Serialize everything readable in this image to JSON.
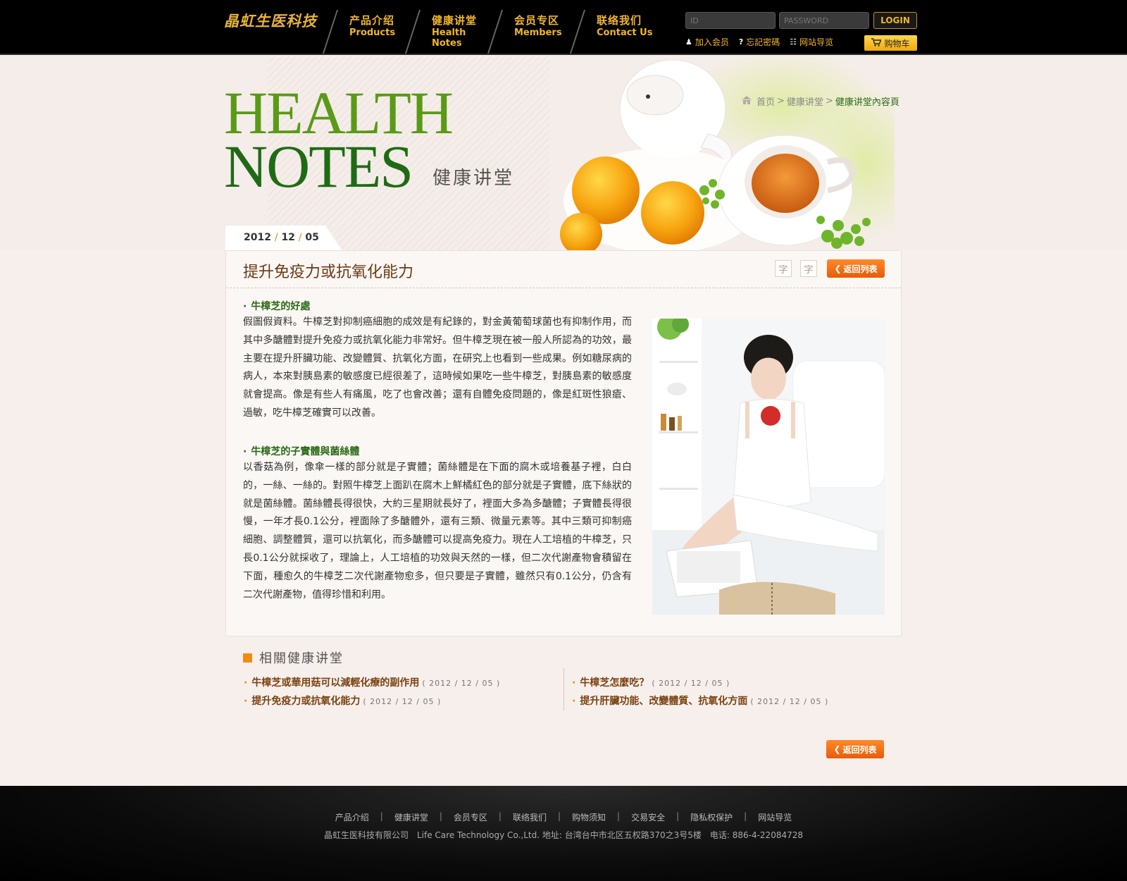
{
  "header": {
    "logo": "晶虹生医科技",
    "nav": [
      {
        "cn": "产品介绍",
        "en": "Products"
      },
      {
        "cn": "健康讲堂",
        "en": "Health Notes"
      },
      {
        "cn": "会员专区",
        "en": "Members"
      },
      {
        "cn": "联络我们",
        "en": "Contact Us"
      }
    ],
    "login": {
      "id_placeholder": "ID",
      "password_placeholder": "PASSWORD",
      "button": "LOGIN"
    },
    "links": {
      "join": "加入会员",
      "forgot": "忘記密碼",
      "sitemap": "网站导览",
      "cart": "购物车"
    }
  },
  "banner": {
    "title_line1": "HEALTH",
    "title_line2": "NOTES",
    "subtitle": "健康讲堂",
    "breadcrumb": {
      "home": "首页",
      "section": "健康讲堂",
      "current": "健康讲堂內容頁",
      "sep": ">"
    }
  },
  "article": {
    "date": {
      "y": "2012",
      "m": "12",
      "d": "05",
      "sep": "/"
    },
    "title": "提升免疫力或抗氧化能力",
    "font_small": "字",
    "font_large": "字",
    "back": "返回列表",
    "sections": [
      {
        "heading": "牛樟芝的好處",
        "body": "假圖假資料。牛樟芝對抑制癌細胞的成效是有紀錄的，對金黃葡萄球菌也有抑制作用，而其中多醣體對提升免疫力或抗氧化能力非常好。但牛樟芝現在被一般人所認為的功效，最主要在提升肝臟功能、改變體質、抗氧化方面，在研究上也看到一些成果。例如糖尿病的病人，本來對胰島素的敏感度已經很差了，這時候如果吃一些牛樟芝，對胰島素的敏感度就會提高。像是有些人有痛風，吃了也會改善；還有自體免疫問題的，像是紅斑性狼瘡、過敏，吃牛樟芝確實可以改善。"
      },
      {
        "heading": "牛樟芝的子實體與菌絲體",
        "body": "以香菇為例，像傘一樣的部分就是子實體；菌絲體是在下面的腐木或培養基子裡，白白的，一絲、一絲的。對照牛樟芝上面趴在腐木上鮮橘紅色的部分就是子實體，底下絲狀的就是菌絲體。菌絲體長得很快，大約三星期就長好了，裡面大多為多醣體；子實體長得很慢，一年才長0.1公分，裡面除了多醣體外，還有三類、微量元素等。其中三類可抑制癌細胞、調整體質，還可以抗氧化，而多醣體可以提高免疫力。現在人工培植的牛樟芝，只長0.1公分就採收了，理論上，人工培植的功效與天然的一樣，但二次代謝產物會積留在下面，種愈久的牛樟芝二次代謝產物愈多，但只要是子實體，雖然只有0.1公分，仍含有二次代謝產物，值得珍惜和利用。"
      }
    ]
  },
  "related": {
    "title": "相關健康讲堂",
    "items": [
      {
        "title": "牛樟芝或華用菇可以減輕化療的副作用",
        "date": "( 2012 / 12 / 05 )"
      },
      {
        "title": "提升免疫力或抗氧化能力",
        "date": "( 2012 / 12 / 05 )"
      },
      {
        "title": "牛樟芝怎麼吃？",
        "date": "( 2012 / 12 / 05 )"
      },
      {
        "title": "提升肝臟功能、改變體質、抗氧化方面",
        "date": "( 2012 / 12 / 05 )"
      }
    ],
    "back": "返回列表"
  },
  "footer": {
    "links": [
      "产品介绍",
      "健康讲堂",
      "会员专区",
      "联络我们",
      "购物须知",
      "交易安全",
      "隐私权保护",
      "网站导览"
    ],
    "sep": "|",
    "info": "晶虹生医科技有限公司　Life Care Technology Co.,Ltd. 地址: 台湾台中市北区五权路370之3号5楼　电话: 886-4-22084728"
  },
  "icons": [
    "home-icon",
    "user-icon",
    "question-icon",
    "sitemap-icon",
    "cart-icon",
    "chevron-left-icon"
  ],
  "colors": {
    "accent_gold": "#f0b62b",
    "accent_orange": "#e85b08",
    "title_green": "#1f6b15",
    "link_brown": "#7a4211"
  }
}
